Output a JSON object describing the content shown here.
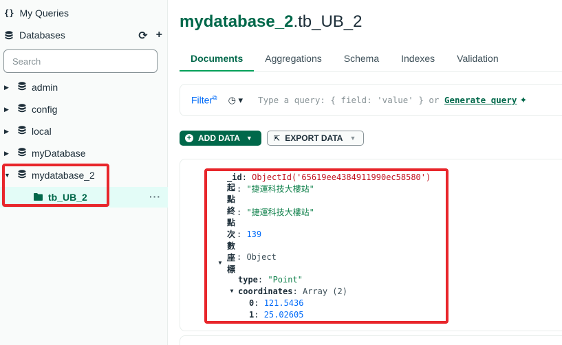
{
  "sidebar": {
    "my_queries": "My Queries",
    "databases": "Databases",
    "search_placeholder": "Search",
    "databases_list": [
      "admin",
      "config",
      "local",
      "myDatabase",
      "mydatabase_2"
    ],
    "selected_collection": "tb_UB_2",
    "more": "···"
  },
  "main": {
    "title_db": "mydatabase_2",
    "title_coll": ".tb_UB_2",
    "tabs": [
      "Documents",
      "Aggregations",
      "Schema",
      "Indexes",
      "Validation"
    ],
    "query": {
      "filter_label": "Filter",
      "placeholder_prefix": "Type a query: { field: 'value' } or ",
      "generate_query": "Generate query"
    },
    "buttons": {
      "add_data": "ADD DATA",
      "export_data": "EXPORT DATA"
    },
    "document": {
      "id_key": "_id",
      "id_value": "ObjectId('65619ee4384911990ec58580')",
      "start_key": "起點",
      "start_value": "\"捷運科技大樓站\"",
      "end_key": "終點",
      "end_value": "\"捷運科技大樓站\"",
      "count_key": "次數",
      "count_value": "139",
      "coord_key": "座標",
      "coord_value": "Object",
      "type_key": "type",
      "type_value": "\"Point\"",
      "coords_key": "coordinates",
      "coords_value": "Array (2)",
      "idx0": "0",
      "val0": "121.5436",
      "idx1": "1",
      "val1": "25.02605"
    }
  },
  "colors": {
    "accent_green": "#00684a",
    "highlight_red": "#e8262b",
    "link_blue": "#016bf8"
  }
}
